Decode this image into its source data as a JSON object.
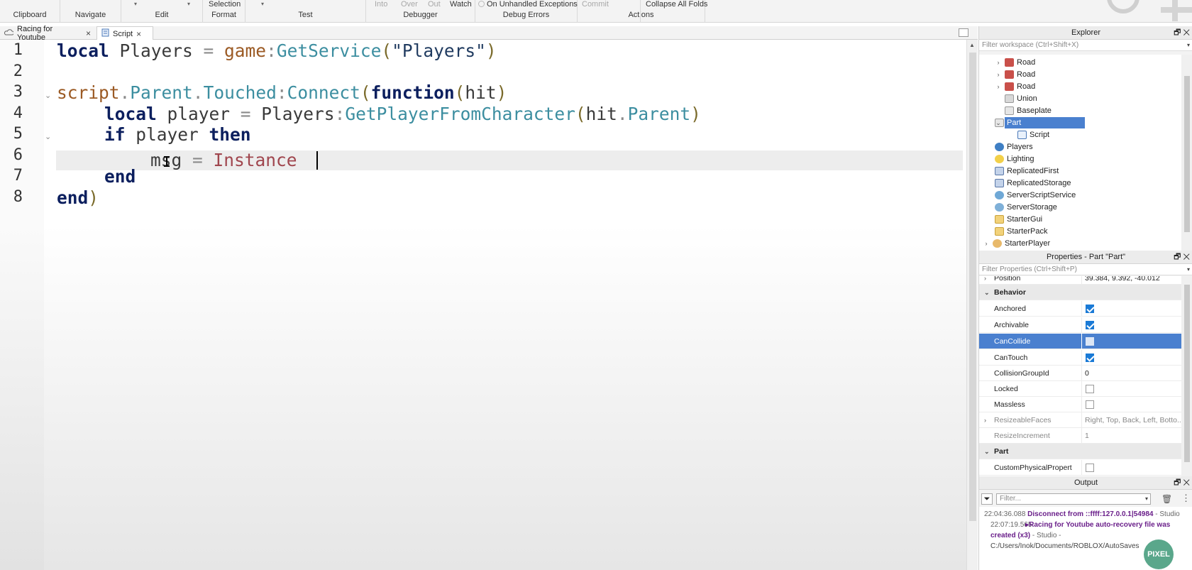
{
  "ribbon": {
    "groups": [
      {
        "label": "Clipboard"
      },
      {
        "label": "Navigate"
      },
      {
        "label": "Edit"
      },
      {
        "label": "Format",
        "top": "Selection"
      },
      {
        "label": "Test"
      },
      {
        "label": "Debugger",
        "items": [
          "Into",
          "Over",
          "Out",
          "Watch"
        ]
      },
      {
        "label": "Debug Errors",
        "top": "On Unhandled Exceptions"
      },
      {
        "label": "Actions",
        "items": [
          "Commit"
        ]
      },
      {
        "top": "Collapse All Folds"
      }
    ]
  },
  "tabs": [
    {
      "label": "Racing for Youtube",
      "icon": "cloud-icon"
    },
    {
      "label": "Script",
      "icon": "script-icon"
    }
  ],
  "editor": {
    "line_numbers": [
      "1",
      "2",
      "3",
      "4",
      "5",
      "6",
      "7",
      "8"
    ],
    "active_line": 6,
    "lines": {
      "l1": [
        "local",
        " Players ",
        "=",
        " game",
        ":",
        "GetService",
        "(",
        "\"Players\"",
        ")"
      ],
      "l3": [
        "script",
        ".",
        "Parent",
        ".",
        "Touched",
        ":",
        "Connect",
        "(",
        "function",
        "(",
        "hit",
        ")"
      ],
      "l4": [
        "local",
        " player ",
        "=",
        " Players",
        ":",
        "GetPlayerFromCharacter",
        "(",
        "hit",
        ".",
        "Parent",
        ")"
      ],
      "l5": [
        "if",
        " player ",
        "then"
      ],
      "l6": [
        "msg ",
        "=",
        " Instance"
      ],
      "l7": [
        "end"
      ],
      "l8": [
        "end",
        ")"
      ]
    }
  },
  "explorer": {
    "title": "Explorer",
    "filter_placeholder": "Filter workspace (Ctrl+Shift+X)",
    "items": [
      {
        "label": "Road",
        "icon": "model-icon"
      },
      {
        "label": "Road",
        "icon": "model-icon"
      },
      {
        "label": "Road",
        "icon": "model-icon"
      },
      {
        "label": "Union",
        "icon": "union-icon"
      },
      {
        "label": "Baseplate",
        "icon": "part-icon"
      },
      {
        "label": "Part",
        "icon": "part-icon",
        "selected": true
      },
      {
        "label": "Script",
        "icon": "script-icon"
      },
      {
        "label": "Players",
        "icon": "players-icon"
      },
      {
        "label": "Lighting",
        "icon": "lightbulb-icon"
      },
      {
        "label": "ReplicatedFirst",
        "icon": "replicated-icon"
      },
      {
        "label": "ReplicatedStorage",
        "icon": "replicated-icon"
      },
      {
        "label": "ServerScriptService",
        "icon": "server-script-icon"
      },
      {
        "label": "ServerStorage",
        "icon": "server-storage-icon"
      },
      {
        "label": "StarterGui",
        "icon": "folder-icon"
      },
      {
        "label": "StarterPack",
        "icon": "folder-icon"
      },
      {
        "label": "StarterPlayer",
        "icon": "starter-player-icon"
      }
    ]
  },
  "properties": {
    "title": "Properties - Part \"Part\"",
    "filter_placeholder": "Filter Properties (Ctrl+Shift+P)",
    "rows": [
      {
        "name": "Position",
        "value": "39.384, 9.392, -40.012"
      },
      {
        "name": "Behavior",
        "category": true
      },
      {
        "name": "Anchored",
        "checked": true
      },
      {
        "name": "Archivable",
        "checked": true
      },
      {
        "name": "CanCollide",
        "checked": false,
        "selected": true
      },
      {
        "name": "CanTouch",
        "checked": true
      },
      {
        "name": "CollisionGroupId",
        "value": "0"
      },
      {
        "name": "Locked",
        "checked": false
      },
      {
        "name": "Massless",
        "checked": false
      },
      {
        "name": "ResizeableFaces",
        "value": "Right, Top, Back, Left, Botto..."
      },
      {
        "name": "ResizeIncrement",
        "value": "1"
      },
      {
        "name": "Part",
        "category": true
      },
      {
        "name": "CustomPhysicalPropert",
        "checked": false
      }
    ]
  },
  "output": {
    "title": "Output",
    "filter_placeholder": "Filter...",
    "log1_time": "22:04:36.088",
    "log1_msg": "Disconnect from ::ffff:127.0.0.1|54984",
    "log1_src": " - Studio",
    "log2_time": "22:07:19.565",
    "log2_msg": "▸Racing for Youtube auto-recovery file was created (x3)",
    "log2_src": " - Studio - ",
    "log2_path": "C:/Users/Inok/Documents/ROBLOX/AutoSaves"
  },
  "watermark": "PIXEL",
  "colors": {
    "selection": "#4a80cf",
    "keyword": "#0c1f5e",
    "method": "#3c8ea0",
    "checkbox": "#1a7ad6"
  }
}
